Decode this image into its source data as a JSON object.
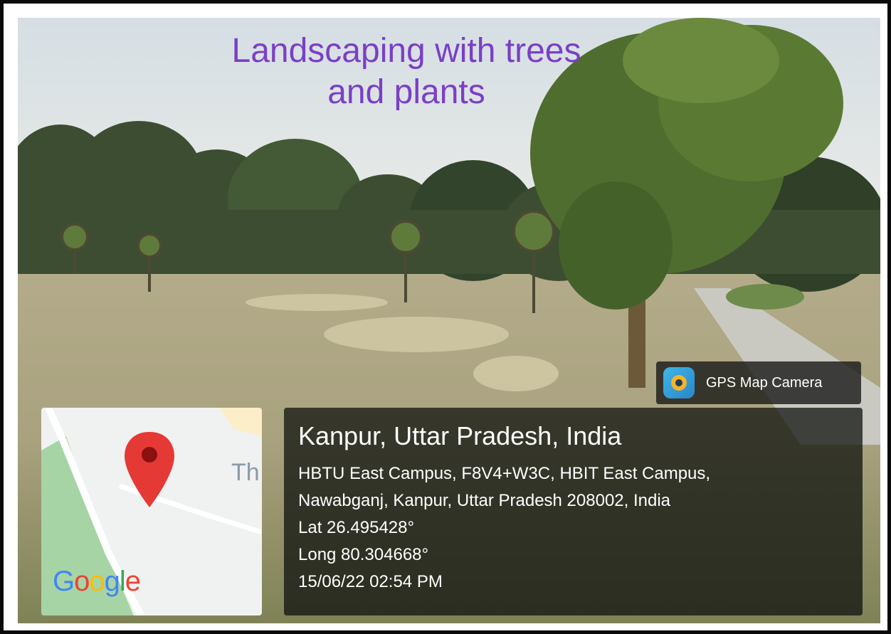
{
  "caption": {
    "line1": "Landscaping with trees",
    "line2": "and plants"
  },
  "gps_badge": {
    "label": "GPS Map Camera"
  },
  "map": {
    "street_fragment": "Th",
    "brand_letters": [
      "G",
      "o",
      "o",
      "g",
      "l",
      "e"
    ],
    "brand_colors": [
      "#4285F4",
      "#EA4335",
      "#FBBC05",
      "#4285F4",
      "#34A853",
      "#EA4335"
    ],
    "pin_color": "#e53935"
  },
  "location": {
    "place": "Kanpur, Uttar Pradesh, India",
    "address_line1": "HBTU East Campus, F8V4+W3C, HBIT East Campus,",
    "address_line2": "Nawabganj, Kanpur, Uttar Pradesh 208002, India",
    "lat": "Lat 26.495428°",
    "long": "Long 80.304668°",
    "datetime": "15/06/22 02:54 PM"
  }
}
